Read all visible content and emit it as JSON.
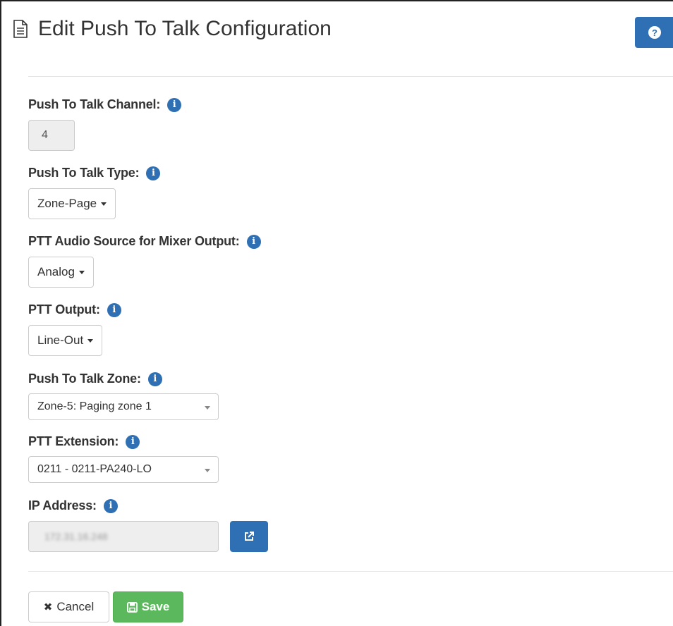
{
  "header": {
    "title": "Edit Push To Talk Configuration",
    "help_icon": "?"
  },
  "fields": {
    "channel": {
      "label": "Push To Talk Channel:",
      "value": "4"
    },
    "type": {
      "label": "Push To Talk Type:",
      "value": "Zone-Page"
    },
    "audio_source": {
      "label": "PTT Audio Source for Mixer Output:",
      "value": "Analog"
    },
    "output": {
      "label": "PTT Output:",
      "value": "Line-Out"
    },
    "zone": {
      "label": "Push To Talk Zone:",
      "value": "Zone-5: Paging zone 1"
    },
    "extension": {
      "label": "PTT Extension:",
      "value": "0211 - 0211-PA240-LO"
    },
    "ip_address": {
      "label": "IP Address:",
      "value": "172.31.16.248"
    }
  },
  "info_icon": "i",
  "buttons": {
    "cancel": "Cancel",
    "cancel_icon": "✖",
    "save": "Save"
  },
  "colors": {
    "primary": "#2f6fb3",
    "success": "#5cb85c"
  }
}
